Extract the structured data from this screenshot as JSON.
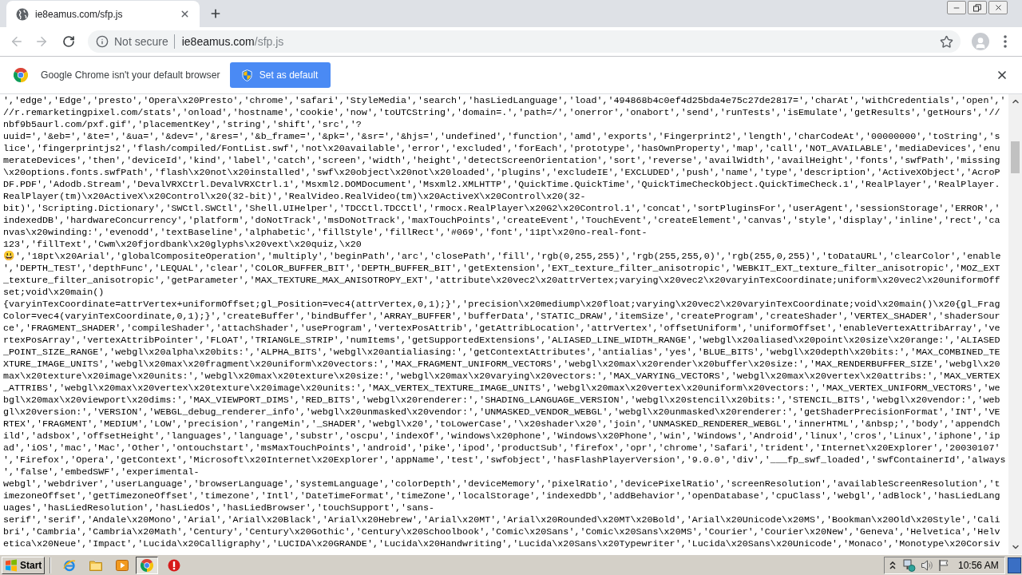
{
  "browser": {
    "tabs": [
      {
        "title": "ie8eamus.com/sfp.js",
        "selected": true
      }
    ],
    "address": {
      "security": "Not secure",
      "host": "ie8eamus.com",
      "path": "/sfp.js"
    }
  },
  "infobar": {
    "message": "Google Chrome isn't your default browser",
    "button": "Set as default"
  },
  "code_lines": [
    "','edge','Edge','presto','Opera\\x20Presto','chrome','safari','StyleMedia','search','hasLiedLanguage','load','494868b4c0ef4d25bda4e75c27de2817=','charAt','withCredentials','open','",
    "//r.remarketingpixel.com/stats','onload','hostname','cookie','now','toUTCString','domain=.','path=/','onerror','onabort','send','runTests','isEmulate','getResults','getHours','//",
    "nbf9b5aurl.com/pxf.gif','placementKey','string','shift','src','?",
    "uuid=','&eb=','&te=','&ua=','&dev=','&res=','&b_frame=','&pk=','&sr=','&hjs=','undefined','function','amd','exports','Fingerprint2','length','charCodeAt','00000000','toString','s",
    "lice','fingerprintjs2','flash/compiled/FontList.swf','not\\x20available','error','excluded','forEach','prototype','hasOwnProperty','map','call','NOT_AVAILABLE','mediaDevices','enu",
    "merateDevices','then','deviceId','kind','label','catch','screen','width','height','detectScreenOrientation','sort','reverse','availWidth','availHeight','fonts','swfPath','missing",
    "\\x20options.fonts.swfPath','flash\\x20not\\x20installed','swf\\x20object\\x20not\\x20loaded','plugins','excludeIE','EXCLUDED','push','name','type','description','ActiveXObject','AcroP",
    "DF.PDF','Adodb.Stream','DevalVRXCtrl.DevalVRXCtrl.1','Msxml2.DOMDocument','Msxml2.XMLHTTP','QuickTime.QuickTime','QuickTimeCheckObject.QuickTimeCheck.1','RealPlayer','RealPlayer.",
    "RealPlayer(tm)\\x20ActiveX\\x20Control\\x20(32-bit)','RealVideo.RealVideo(tm)\\x20ActiveX\\x20Control\\x20(32-",
    "bit)','Scripting.Dictionary','SWCtl.SWCtl','Shell.UIHelper','TDCCtl.TDCCtl','rmocx.RealPlayer\\x20G2\\x20Control.1','concat','sortPluginsFor','userAgent','sessionStorage','ERROR','",
    "indexedDB','hardwareConcurrency','platform','doNotTrack','msDoNotTrack','maxTouchPoints','createEvent','TouchEvent','createElement','canvas','style','display','inline','rect','ca",
    "nvas\\x20winding:','evenodd','textBaseline','alphabetic','fillStyle','fillRect','#069','font','11pt\\x20no-real-font-",
    "123','fillText','Cwm\\x20fjordbank\\x20glyphs\\x20vext\\x20quiz,\\x20",
    "😃','18pt\\x20Arial','globalCompositeOperation','multiply','beginPath','arc','closePath','fill','rgb(0,255,255)','rgb(255,255,0)','rgb(255,0,255)','toDataURL','clearColor','enable",
    "','DEPTH_TEST','depthFunc','LEQUAL','clear','COLOR_BUFFER_BIT','DEPTH_BUFFER_BIT','getExtension','EXT_texture_filter_anisotropic','WEBKIT_EXT_texture_filter_anisotropic','MOZ_EXT",
    "_texture_filter_anisotropic','getParameter','MAX_TEXTURE_MAX_ANISOTROPY_EXT','attribute\\x20vec2\\x20attrVertex;varying\\x20vec2\\x20varyinTexCoordinate;uniform\\x20vec2\\x20uniformOff",
    "set;void\\x20main()",
    "{varyinTexCoordinate=attrVertex+uniformOffset;gl_Position=vec4(attrVertex,0,1);}','precision\\x20mediump\\x20float;varying\\x20vec2\\x20varyinTexCoordinate;void\\x20main()\\x20{gl_Frag",
    "Color=vec4(varyinTexCoordinate,0,1);}','createBuffer','bindBuffer','ARRAY_BUFFER','bufferData','STATIC_DRAW','itemSize','createProgram','createShader','VERTEX_SHADER','shaderSour",
    "ce','FRAGMENT_SHADER','compileShader','attachShader','useProgram','vertexPosAttrib','getAttribLocation','attrVertex','offsetUniform','uniformOffset','enableVertexAttribArray','ve",
    "rtexPosArray','vertexAttribPointer','FLOAT','TRIANGLE_STRIP','numItems','getSupportedExtensions','ALIASED_LINE_WIDTH_RANGE','webgl\\x20aliased\\x20point\\x20size\\x20range:','ALIASED",
    "_POINT_SIZE_RANGE','webgl\\x20alpha\\x20bits:','ALPHA_BITS','webgl\\x20antialiasing:','getContextAttributes','antialias','yes','BLUE_BITS','webgl\\x20depth\\x20bits:','MAX_COMBINED_TE",
    "XTURE_IMAGE_UNITS','webgl\\x20max\\x20fragment\\x20uniform\\x20vectors:','MAX_FRAGMENT_UNIFORM_VECTORS','webgl\\x20max\\x20render\\x20buffer\\x20size:','MAX_RENDERBUFFER_SIZE','webgl\\x20",
    "max\\x20texture\\x20image\\x20units:','webgl\\x20max\\x20texture\\x20size:','webgl\\x20max\\x20varying\\x20vectors:','MAX_VARYING_VECTORS','webgl\\x20max\\x20vertex\\x20attribs:','MAX_VERTEX",
    "_ATTRIBS','webgl\\x20max\\x20vertex\\x20texture\\x20image\\x20units:','MAX_VERTEX_TEXTURE_IMAGE_UNITS','webgl\\x20max\\x20vertex\\x20uniform\\x20vectors:','MAX_VERTEX_UNIFORM_VECTORS','we",
    "bgl\\x20max\\x20viewport\\x20dims:','MAX_VIEWPORT_DIMS','RED_BITS','webgl\\x20renderer:','SHADING_LANGUAGE_VERSION','webgl\\x20stencil\\x20bits:','STENCIL_BITS','webgl\\x20vendor:','web",
    "gl\\x20version:','VERSION','WEBGL_debug_renderer_info','webgl\\x20unmasked\\x20vendor:','UNMASKED_VENDOR_WEBGL','webgl\\x20unmasked\\x20renderer:','getShaderPrecisionFormat','INT','VE",
    "RTEX','FRAGMENT','MEDIUM','LOW','precision','rangeMin','_SHADER','webgl\\x20','toLowerCase','\\x20shader\\x20','join','UNMASKED_RENDERER_WEBGL','innerHTML','&nbsp;','body','appendCh",
    "ild','adsbox','offsetHeight','languages','language','substr','oscpu','indexOf','windows\\x20phone','Windows\\x20Phone','win','Windows','Android','linux','cros','Linux','iphone','ip",
    "ad','iOS','mac','Mac','Other','ontouchstart','msMaxTouchPoints','android','pike','ipod','productSub','firefox','opr','chrome','Safari','trident','Internet\\x20Explorer','20030107'",
    "','Firefox','Opera','getContext','Microsoft\\x20Internet\\x20Explorer','appName','test','swfobject','hasFlashPlayerVersion','9.0.0','div','___fp_swf_loaded','swfContainerId','always",
    "','false','embedSWF','experimental-",
    "webgl','webdriver','userLanguage','browserLanguage','systemLanguage','colorDepth','deviceMemory','pixelRatio','devicePixelRatio','screenResolution','availableScreenResolution','t",
    "imezoneOffset','getTimezoneOffset','timezone','Intl','DateTimeFormat','timeZone','localStorage','indexedDb','addBehavior','openDatabase','cpuClass','webgl','adBlock','hasLiedLang",
    "uages','hasLiedResolution','hasLiedOs','hasLiedBrowser','touchSupport','sans-",
    "serif','serif','Andale\\x20Mono','Arial','Arial\\x20Black','Arial\\x20Hebrew','Arial\\x20MT','Arial\\x20Rounded\\x20MT\\x20Bold','Arial\\x20Unicode\\x20MS','Bookman\\x20Old\\x20Style','Cali",
    "bri','Cambria','Cambria\\x20Math','Century','Century\\x20Gothic','Century\\x20Schoolbook','Comic\\x20Sans','Comic\\x20Sans\\x20MS','Courier','Courier\\x20New','Geneva','Helvetica','Helv",
    "etica\\x20Neue','Impact','Lucida\\x20Calligraphy','LUCIDA\\x20GRANDE','Lucida\\x20Handwriting','Lucida\\x20Sans\\x20Typewriter','Lucida\\x20Sans\\x20Unicode','Monaco','Monotype\\x20Corsiv"
  ],
  "taskbar": {
    "start": "Start",
    "clock": "10:56 AM"
  }
}
